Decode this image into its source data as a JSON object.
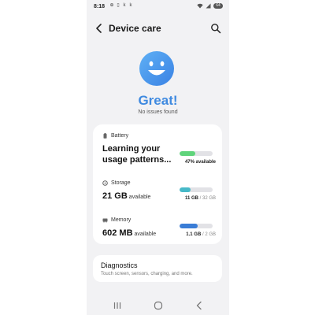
{
  "status_bar": {
    "time": "8:18",
    "notifications": [
      "⊕",
      "▯",
      "k",
      "k"
    ],
    "battery": "64"
  },
  "header": {
    "title": "Device care"
  },
  "hero": {
    "title": "Great!",
    "subtitle": "No issues found",
    "accent_color": "#3f8ae0"
  },
  "battery": {
    "label": "Battery",
    "headline": "Learning your usage patterns...",
    "percent": 47,
    "caption": "47% available",
    "color": "#5fd47b"
  },
  "storage": {
    "label": "Storage",
    "value": "21 GB",
    "unit": "available",
    "used": "11 GB",
    "total": "/ 32 GB",
    "fraction": 0.34,
    "color": "#46b9c8"
  },
  "memory": {
    "label": "Memory",
    "value": "602 MB",
    "unit": "available",
    "used": "1.1 GB",
    "total": "/ 2 GB",
    "fraction": 0.55,
    "color": "#3a7dd6"
  },
  "diagnostics": {
    "title": "Diagnostics",
    "subtitle": "Touch screen, sensors, charging, and more."
  }
}
